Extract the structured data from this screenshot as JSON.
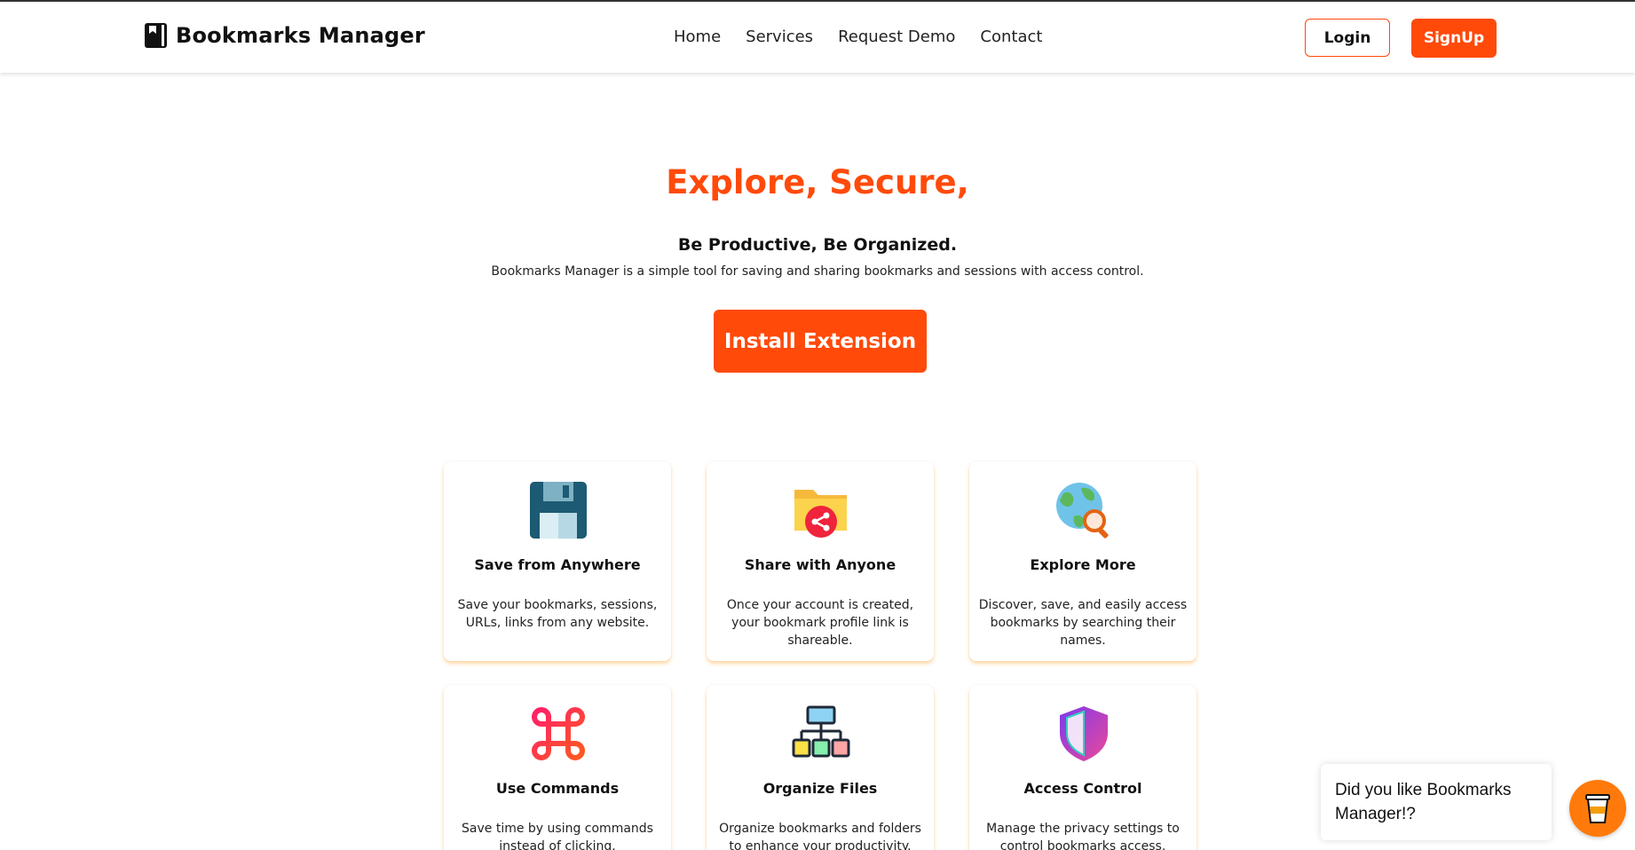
{
  "brand": {
    "name": "Bookmarks Manager",
    "icon": "bookmark-icon"
  },
  "nav": {
    "links": [
      {
        "label": "Home"
      },
      {
        "label": "Services"
      },
      {
        "label": "Request Demo"
      },
      {
        "label": "Contact"
      }
    ],
    "login_label": "Login",
    "signup_label": "SignUp"
  },
  "hero": {
    "title": "Explore, Secure,",
    "subtitle": "Be Productive, Be Organized.",
    "description": "Bookmarks Manager is a simple tool for saving and sharing bookmarks and sessions with access control.",
    "cta_label": "Install Extension"
  },
  "features": [
    {
      "title": "Save from Anywhere",
      "description": "Save your bookmarks, sessions, URLs, links from any website.",
      "icon": "floppy-disk-icon"
    },
    {
      "title": "Share with Anyone",
      "description": "Once your account is created, your bookmark profile link is shareable.",
      "icon": "shared-folder-icon"
    },
    {
      "title": "Explore More",
      "description": "Discover, save, and easily access bookmarks by searching their names.",
      "icon": "globe-search-icon"
    },
    {
      "title": "Use Commands",
      "description": "Save time by using commands instead of clicking.",
      "icon": "command-key-icon"
    },
    {
      "title": "Organize Files",
      "description": "Organize bookmarks and folders to enhance your productivity.",
      "icon": "hierarchy-icon"
    },
    {
      "title": "Access Control",
      "description": "Manage the privacy settings to control bookmarks access.",
      "icon": "shield-icon"
    }
  ],
  "chat": {
    "message": "Did you like Bookmarks Manager!?",
    "fab_icon": "coffee-cup-icon"
  },
  "colors": {
    "accent": "#ff4a0a",
    "text": "#111111",
    "card_shadow": "#ffaa3c"
  }
}
